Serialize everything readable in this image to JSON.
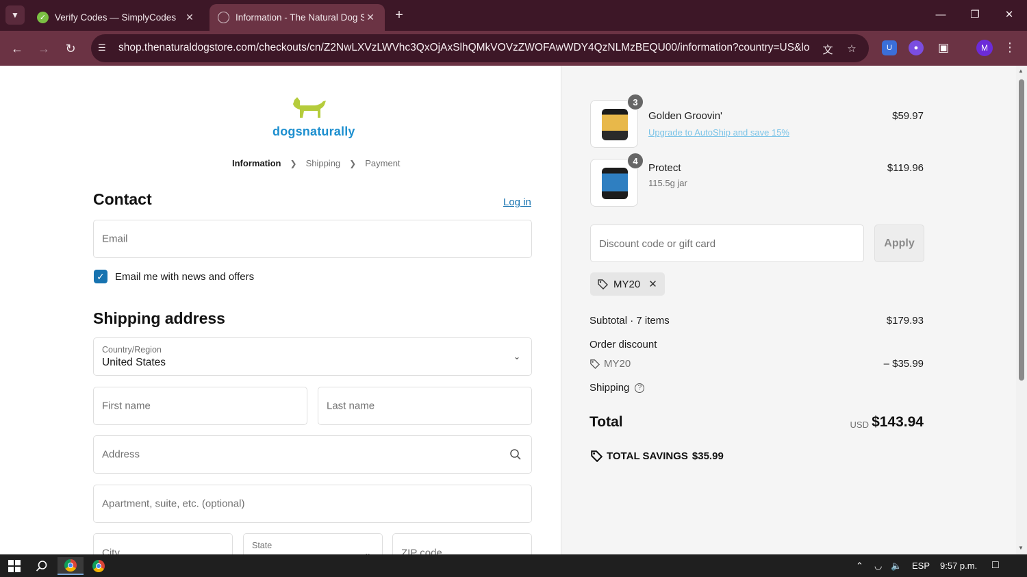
{
  "browser": {
    "tabs": [
      {
        "title": "Verify Codes — SimplyCodes"
      },
      {
        "title": "Information - The Natural Dog Store"
      }
    ],
    "url": "shop.thenaturaldogstore.com/checkouts/cn/Z2NwLXVzLWVhc3QxOjAxSlhQMkVOVzZWOFAwWDY4QzNLMzBEQU00/information?country=US&log...",
    "profile_initial": "M"
  },
  "store": {
    "logo_text": "dogsnaturally",
    "brand_color": "#1d8fcf",
    "logo_dog_color": "#b5cc3c"
  },
  "breadcrumb": {
    "steps": [
      "Information",
      "Shipping",
      "Payment"
    ]
  },
  "contact": {
    "heading": "Contact",
    "login_label": "Log in",
    "email_placeholder": "Email",
    "newsletter_label": "Email me with news and offers",
    "newsletter_checked": true
  },
  "shipping": {
    "heading": "Shipping address",
    "country_label": "Country/Region",
    "country_value": "United States",
    "first_name_placeholder": "First name",
    "last_name_placeholder": "Last name",
    "address_placeholder": "Address",
    "apartment_placeholder": "Apartment, suite, etc. (optional)",
    "city_placeholder": "City",
    "state_label": "State",
    "zip_placeholder": "ZIP code"
  },
  "summary": {
    "items": [
      {
        "name": "Golden Groovin'",
        "link": "Upgrade to AutoShip and save 15%",
        "price": "$59.97",
        "qty": "3"
      },
      {
        "name": "Protect",
        "variant": "115.5g jar",
        "price": "$119.96",
        "qty": "4"
      }
    ],
    "discount_placeholder": "Discount code or gift card",
    "apply_label": "Apply",
    "applied_code": "MY20",
    "subtotal_label": "Subtotal · 7 items",
    "subtotal_value": "$179.93",
    "order_discount_label": "Order discount",
    "discount_code": "MY20",
    "discount_value": "– $35.99",
    "shipping_label": "Shipping",
    "total_label": "Total",
    "currency": "USD",
    "total_value": "$143.94",
    "savings_label": "TOTAL SAVINGS",
    "savings_value": "$35.99"
  },
  "taskbar": {
    "language": "ESP",
    "time": "9:57 p.m."
  }
}
